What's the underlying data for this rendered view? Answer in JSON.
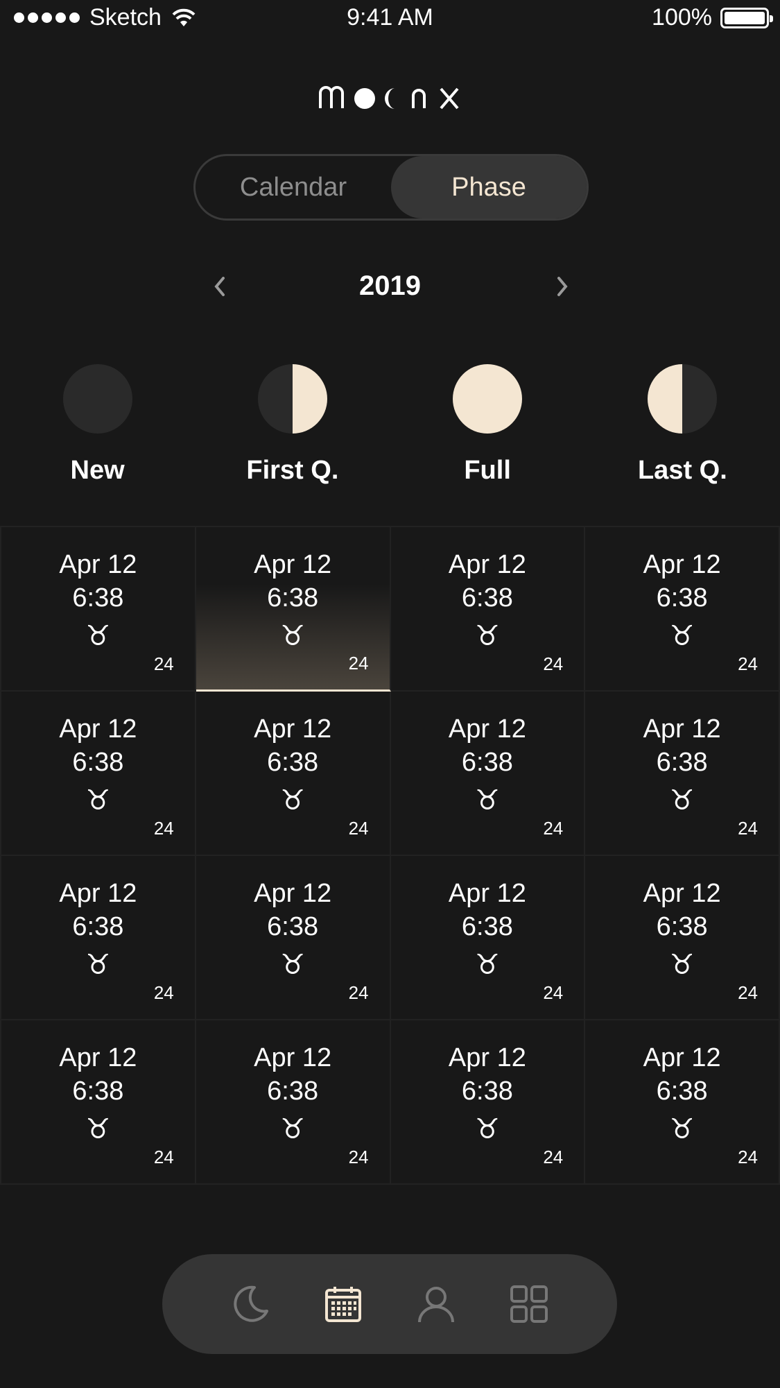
{
  "status_bar": {
    "carrier": "Sketch",
    "time": "9:41 AM",
    "battery": "100%"
  },
  "app": {
    "logo": "moonx"
  },
  "segment": {
    "calendar_label": "Calendar",
    "phase_label": "Phase",
    "selected": "Phase"
  },
  "year_nav": {
    "year": "2019"
  },
  "phases": [
    {
      "label": "New",
      "icon": "new-moon-icon"
    },
    {
      "label": "First Q.",
      "icon": "first-quarter-icon"
    },
    {
      "label": "Full",
      "icon": "full-moon-icon"
    },
    {
      "label": "Last Q.",
      "icon": "last-quarter-icon"
    }
  ],
  "colors": {
    "accent": "#f4e6d2",
    "background": "#181818",
    "tabbar": "#353535",
    "moon_dark": "#2a2a2a"
  },
  "grid": {
    "rows": [
      [
        {
          "date": "Apr 12",
          "time": "6:38",
          "sign": "♉",
          "num": "24"
        },
        {
          "date": "Apr 12",
          "time": "6:38",
          "sign": "♉",
          "num": "24",
          "selected": true
        },
        {
          "date": "Apr 12",
          "time": "6:38",
          "sign": "♉",
          "num": "24"
        },
        {
          "date": "Apr 12",
          "time": "6:38",
          "sign": "♉",
          "num": "24"
        }
      ],
      [
        {
          "date": "Apr 12",
          "time": "6:38",
          "sign": "♉",
          "num": "24"
        },
        {
          "date": "Apr 12",
          "time": "6:38",
          "sign": "♉",
          "num": "24"
        },
        {
          "date": "Apr 12",
          "time": "6:38",
          "sign": "♉",
          "num": "24"
        },
        {
          "date": "Apr 12",
          "time": "6:38",
          "sign": "♉",
          "num": "24"
        }
      ],
      [
        {
          "date": "Apr 12",
          "time": "6:38",
          "sign": "♉",
          "num": "24"
        },
        {
          "date": "Apr 12",
          "time": "6:38",
          "sign": "♉",
          "num": "24"
        },
        {
          "date": "Apr 12",
          "time": "6:38",
          "sign": "♉",
          "num": "24"
        },
        {
          "date": "Apr 12",
          "time": "6:38",
          "sign": "♉",
          "num": "24"
        }
      ],
      [
        {
          "date": "Apr 12",
          "time": "6:38",
          "sign": "♉",
          "num": "24"
        },
        {
          "date": "Apr 12",
          "time": "6:38",
          "sign": "♉",
          "num": "24"
        },
        {
          "date": "Apr 12",
          "time": "6:38",
          "sign": "♉",
          "num": "24"
        },
        {
          "date": "Apr 12",
          "time": "6:38",
          "sign": "♉",
          "num": "24"
        }
      ]
    ]
  },
  "tab_bar": {
    "tabs": [
      {
        "icon": "moon-icon",
        "active": false
      },
      {
        "icon": "calendar-icon",
        "active": true
      },
      {
        "icon": "user-icon",
        "active": false
      },
      {
        "icon": "grid-icon",
        "active": false
      }
    ]
  }
}
